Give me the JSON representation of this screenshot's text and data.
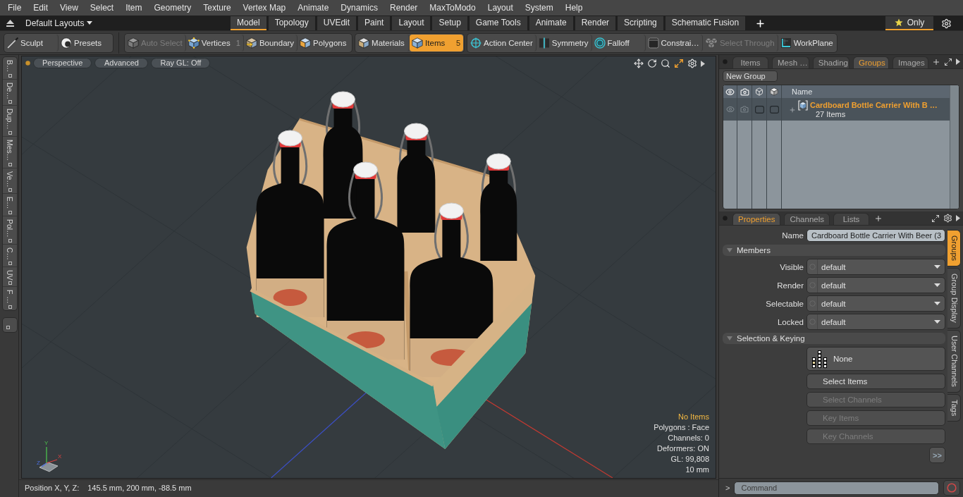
{
  "menu_bar": {
    "items": [
      "File",
      "Edit",
      "View",
      "Select",
      "Item",
      "Geometry",
      "Texture",
      "Vertex Map",
      "Animate",
      "Dynamics",
      "Render",
      "MaxToModo",
      "Layout",
      "System",
      "Help"
    ]
  },
  "layout_bar": {
    "layouts_menu": "Default Layouts",
    "tabs": [
      {
        "label": "Model",
        "selected": true
      },
      {
        "label": "Topology",
        "selected": false
      },
      {
        "label": "UVEdit",
        "selected": false
      },
      {
        "label": "Paint",
        "selected": false
      },
      {
        "label": "Layout",
        "selected": false
      },
      {
        "label": "Setup",
        "selected": false
      },
      {
        "label": "Game Tools",
        "selected": false
      },
      {
        "label": "Animate",
        "selected": false
      },
      {
        "label": "Render",
        "selected": false
      },
      {
        "label": "Scripting",
        "selected": false
      },
      {
        "label": "Schematic Fusion",
        "selected": false
      }
    ],
    "filter": {
      "label": "Only",
      "selected": true
    }
  },
  "toolbar": {
    "groups": [
      [
        {
          "label": "Sculpt",
          "selected": false,
          "disabled": false
        },
        {
          "label": "Presets",
          "selected": false,
          "disabled": false
        }
      ],
      [
        {
          "label": "Auto Select",
          "selected": false,
          "disabled": true
        },
        {
          "label": "Vertices",
          "count": "1",
          "selected": false,
          "disabled": false
        },
        {
          "label": "Boundary",
          "selected": false,
          "disabled": false
        },
        {
          "label": "Polygons",
          "selected": false,
          "disabled": false
        }
      ],
      [
        {
          "label": "Materials",
          "selected": false,
          "disabled": false
        },
        {
          "label": "Items",
          "count": "5",
          "selected": true,
          "disabled": false
        }
      ],
      [
        {
          "label": "Action Center",
          "selected": false,
          "disabled": false
        },
        {
          "label": "Symmetry",
          "selected": false,
          "disabled": false
        },
        {
          "label": "Falloff",
          "selected": false,
          "disabled": false
        },
        {
          "label": "Constrai…",
          "selected": false,
          "disabled": false
        },
        {
          "label": "Select Through",
          "selected": false,
          "disabled": true
        },
        {
          "label": "WorkPlane",
          "selected": false,
          "disabled": false
        }
      ]
    ]
  },
  "tool_tabs": [
    "B…",
    "De…",
    "Dup…",
    "Mes…",
    "Ve…",
    "E…",
    "Pol…",
    "C…",
    "UV",
    "F …"
  ],
  "viewport": {
    "header": [
      "Perspective",
      "Advanced",
      "Ray GL: Off"
    ],
    "selection_info": "No Items",
    "stats": [
      "Polygons : Face",
      "Channels: 0",
      "Deformers: ON",
      "GL: 99,808",
      "10 mm"
    ],
    "axis_labels": [
      "Y",
      "X",
      "Z"
    ]
  },
  "status_bar": {
    "label": "Position X, Y, Z:",
    "value": "145.5 mm, 200 mm, -88.5 mm"
  },
  "groups_panel": {
    "tabs": [
      {
        "label": "Items",
        "selected": false
      },
      {
        "label": "Mesh …",
        "selected": false
      },
      {
        "label": "Shading",
        "selected": false
      },
      {
        "label": "Groups",
        "selected": true
      },
      {
        "label": "Images",
        "selected": false
      }
    ],
    "new_group_button": "New Group",
    "name_column": "Name",
    "rows": [
      {
        "name": "Cardboard Bottle Carrier With B …",
        "count": "27 Items",
        "selected": true
      }
    ]
  },
  "properties_panel": {
    "tabs": [
      {
        "label": "Properties",
        "selected": true
      },
      {
        "label": "Channels",
        "selected": false
      },
      {
        "label": "Lists",
        "selected": false
      }
    ],
    "name_field": {
      "label": "Name",
      "value": "Cardboard Bottle Carrier With Beer (3"
    },
    "sections": [
      {
        "kind": "dropdowns",
        "title": "Members",
        "expanded": true,
        "fields": [
          {
            "label": "Visible",
            "value": "default"
          },
          {
            "label": "Render",
            "value": "default"
          },
          {
            "label": "Selectable",
            "value": "default"
          },
          {
            "label": "Locked",
            "value": "default"
          }
        ]
      },
      {
        "kind": "buttons",
        "title": "Selection & Keying",
        "expanded": true,
        "mode_button": "None",
        "buttons": [
          {
            "label": "Select Items",
            "disabled": false
          },
          {
            "label": "Select Channels",
            "disabled": true
          },
          {
            "label": "Key Items",
            "disabled": true
          },
          {
            "label": "Key Channels",
            "disabled": true
          }
        ],
        "more_button": ">>"
      }
    ],
    "side_tabs": [
      {
        "label": "Groups",
        "selected": true
      },
      {
        "label": "Group Display",
        "selected": false
      },
      {
        "label": "User Channels",
        "selected": false
      },
      {
        "label": "Tags",
        "selected": false
      }
    ]
  },
  "command_bar": {
    "prompt": ">",
    "placeholder": "Command"
  }
}
